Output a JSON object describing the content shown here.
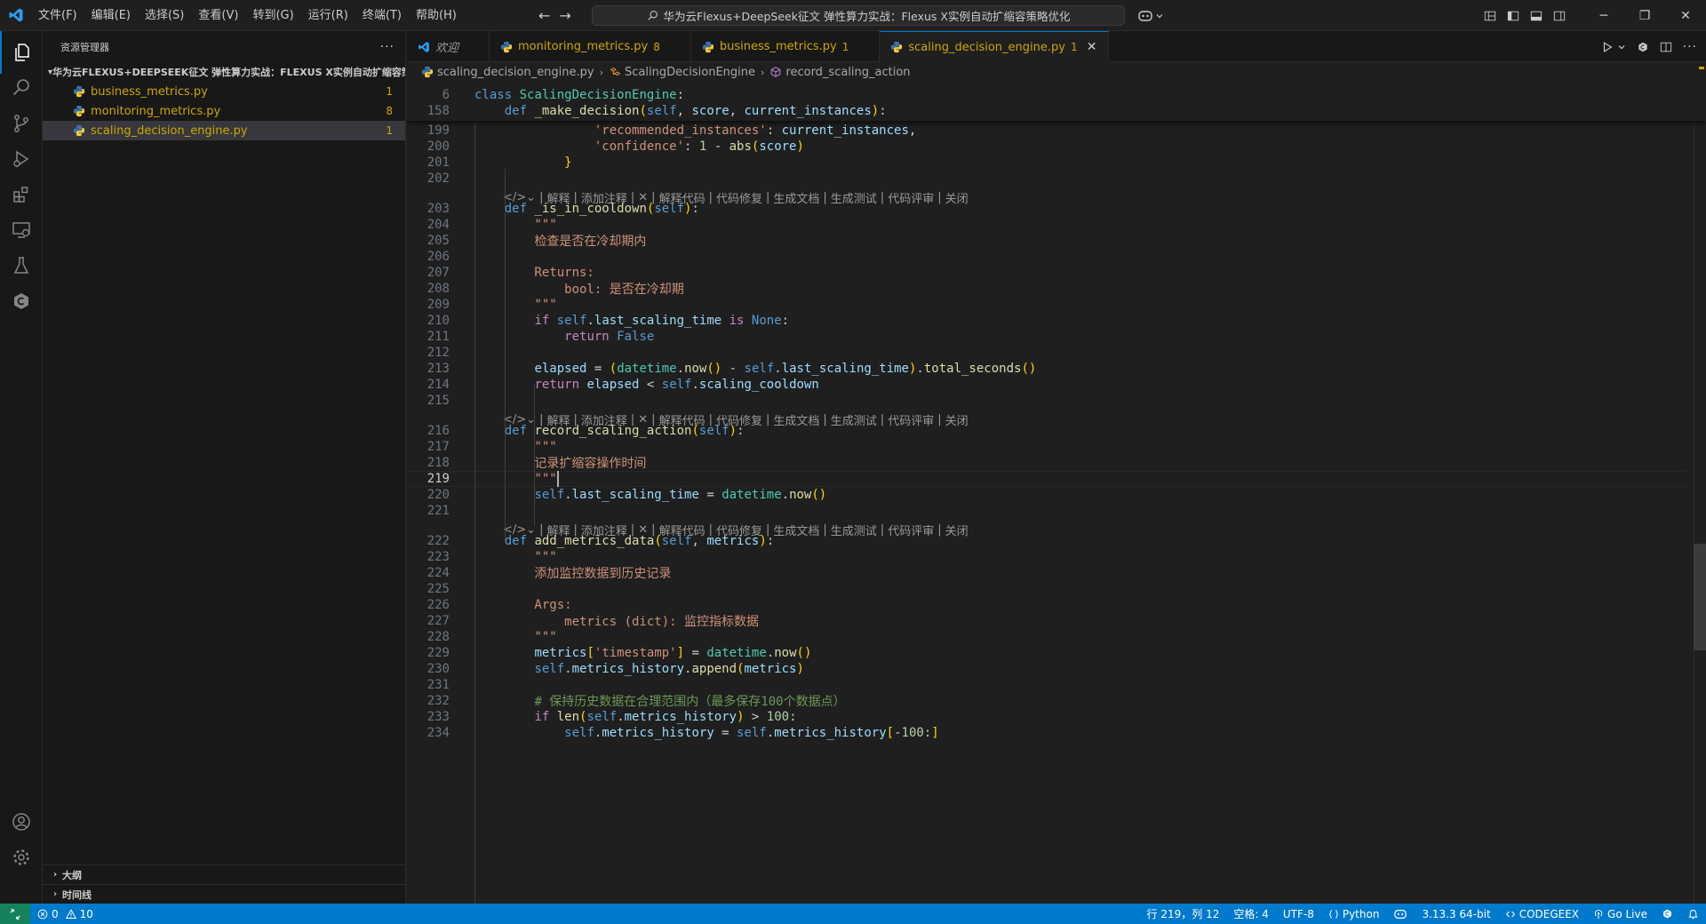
{
  "menu": [
    "文件(F)",
    "编辑(E)",
    "选择(S)",
    "查看(V)",
    "转到(G)",
    "运行(R)",
    "终端(T)",
    "帮助(H)"
  ],
  "command_center": "华为云Flexus+DeepSeek征文 弹性算力实战：Flexus X实例自动扩缩容策略优化",
  "sidebar": {
    "title": "资源管理器",
    "more": "···",
    "folder": "华为云FLEXUS+DEEPSEEK征文 弹性算力实战：FLEXUS X实例自动扩缩容策...",
    "files": [
      {
        "name": "business_metrics.py",
        "badge": "1"
      },
      {
        "name": "monitoring_metrics.py",
        "badge": "8"
      },
      {
        "name": "scaling_decision_engine.py",
        "badge": "1"
      }
    ],
    "outline": "大纲",
    "timeline": "时间线"
  },
  "tabs": [
    {
      "label": "欢迎"
    },
    {
      "label": "monitoring_metrics.py",
      "badge": "8"
    },
    {
      "label": "business_metrics.py",
      "badge": "1"
    },
    {
      "label": "scaling_decision_engine.py",
      "badge": "1",
      "close": "✕"
    }
  ],
  "breadcrumb": [
    "scaling_decision_engine.py",
    "ScalingDecisionEngine",
    "record_scaling_action"
  ],
  "code_lens": {
    "glyph": "</>⌄",
    "items": [
      "解释",
      "添加注释",
      "✕",
      "解释代码",
      "代码修复",
      "生成文档",
      "生成测试",
      "代码评审",
      "关闭"
    ]
  },
  "code": {
    "sticky": [
      {
        "n": "6",
        "t": "class ScalingDecisionEngine:"
      },
      {
        "n": "158",
        "t": "    def _make_decision(self, score, current_instances):"
      }
    ],
    "lines": [
      {
        "n": "199",
        "t": "                'recommended_instances': current_instances,"
      },
      {
        "n": "200",
        "t": "                'confidence': 1 - abs(score)"
      },
      {
        "n": "201",
        "t": "            }"
      },
      {
        "n": "202",
        "t": ""
      },
      {
        "n": "203",
        "t": "    def _is_in_cooldown(self):"
      },
      {
        "n": "204",
        "t": "        \"\"\""
      },
      {
        "n": "205",
        "t": "        检查是否在冷却期内"
      },
      {
        "n": "206",
        "t": ""
      },
      {
        "n": "207",
        "t": "        Returns:"
      },
      {
        "n": "208",
        "t": "            bool: 是否在冷却期"
      },
      {
        "n": "209",
        "t": "        \"\"\""
      },
      {
        "n": "210",
        "t": "        if self.last_scaling_time is None:"
      },
      {
        "n": "211",
        "t": "            return False"
      },
      {
        "n": "212",
        "t": ""
      },
      {
        "n": "213",
        "t": "        elapsed = (datetime.now() - self.last_scaling_time).total_seconds()"
      },
      {
        "n": "214",
        "t": "        return elapsed < self.scaling_cooldown"
      },
      {
        "n": "215",
        "t": ""
      },
      {
        "n": "216",
        "t": "    def record_scaling_action(self):"
      },
      {
        "n": "217",
        "t": "        \"\"\""
      },
      {
        "n": "218",
        "t": "        记录扩缩容操作时间"
      },
      {
        "n": "219",
        "t": "        \"\"\""
      },
      {
        "n": "220",
        "t": "        self.last_scaling_time = datetime.now()"
      },
      {
        "n": "221",
        "t": ""
      },
      {
        "n": "222",
        "t": "    def add_metrics_data(self, metrics):"
      },
      {
        "n": "223",
        "t": "        \"\"\""
      },
      {
        "n": "224",
        "t": "        添加监控数据到历史记录"
      },
      {
        "n": "225",
        "t": ""
      },
      {
        "n": "226",
        "t": "        Args:"
      },
      {
        "n": "227",
        "t": "            metrics (dict): 监控指标数据"
      },
      {
        "n": "228",
        "t": "        \"\"\""
      },
      {
        "n": "229",
        "t": "        metrics['timestamp'] = datetime.now()"
      },
      {
        "n": "230",
        "t": "        self.metrics_history.append(metrics)"
      },
      {
        "n": "231",
        "t": ""
      },
      {
        "n": "232",
        "t": "        # 保持历史数据在合理范围内（最多保存100个数据点）"
      },
      {
        "n": "233",
        "t": "        if len(self.metrics_history) > 100:"
      },
      {
        "n": "234",
        "t": "            self.metrics_history = self.metrics_history[-100:]"
      }
    ]
  },
  "status": {
    "errors": "0",
    "warnings": "10",
    "position": "行 219，列 12",
    "spaces": "空格: 4",
    "encoding": "UTF-8",
    "language": "Python",
    "interpreter": "3.13.3 64-bit",
    "codegeex": "CODEGEEX",
    "golive": "Go Live"
  },
  "colors": {
    "accent": "#0078d4",
    "statusbar": "#007acc",
    "warning": "#cca700"
  }
}
